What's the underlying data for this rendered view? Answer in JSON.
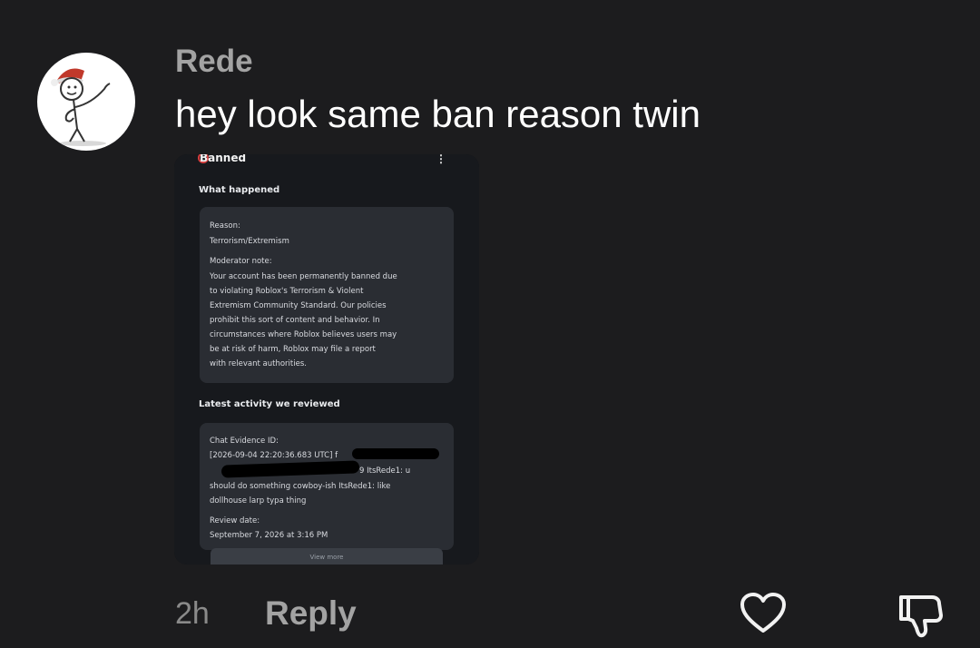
{
  "comment": {
    "username": "Rede",
    "text": "hey look same ban reason twin",
    "time": "2h",
    "reply_label": "Reply"
  },
  "attachment": {
    "status": "Banned",
    "section_what": "What happened",
    "reason_label": "Reason:",
    "reason_value": "Terrorism/Extremism",
    "moderator_label": "Moderator note:",
    "moderator_lines": [
      "Your account has been permanently banned due",
      "to violating Roblox's Terrorism & Violent",
      "Extremism Community Standard. Our policies",
      "prohibit this sort of content and behavior. In",
      "circumstances where Roblox believes users may",
      "be at risk of harm, Roblox may file a report",
      "with relevant authorities."
    ],
    "section_activity": "Latest activity we reviewed",
    "evidence_label": "Chat Evidence ID:",
    "evidence_line1": "[2026-09-04 22:20:36.683 UTC] f",
    "evidence_line2": "9 ItsRede1: u",
    "evidence_line3": "should do something cowboy-ish ItsRede1: like",
    "evidence_line4": "dollhouse larp typa thing",
    "review_label": "Review date:",
    "review_value": "September 7, 2026 at 3:16 PM",
    "view_more": "View more"
  },
  "icons": {
    "like": "heart-outline-icon",
    "dislike": "thumbs-down-outline-icon"
  }
}
